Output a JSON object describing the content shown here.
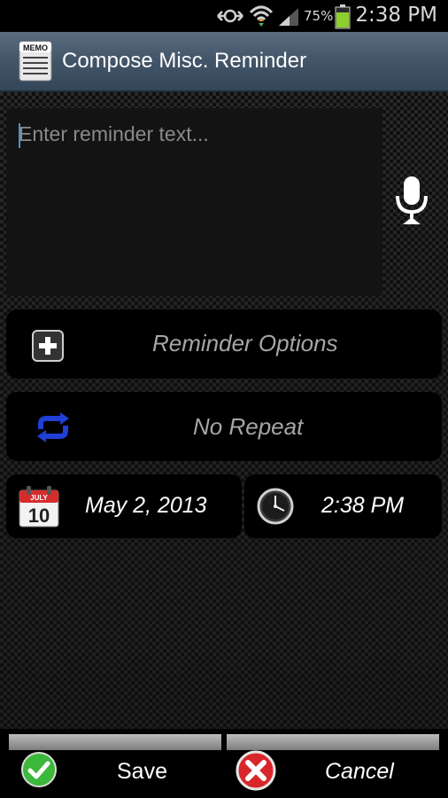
{
  "status_bar": {
    "battery_percent": "75%",
    "time": "2:38 PM"
  },
  "action_bar": {
    "title": "Compose Misc. Reminder",
    "app_icon_text": "MEMO"
  },
  "reminder_text": {
    "value": "",
    "placeholder": "Enter reminder text..."
  },
  "options": {
    "label": "Reminder Options"
  },
  "repeat": {
    "label": "No Repeat"
  },
  "date": {
    "value": "May 2, 2013",
    "calendar_month": "JULY",
    "calendar_day": "10"
  },
  "time": {
    "value": "2:38 PM"
  },
  "footer": {
    "save_label": "Save",
    "cancel_label": "Cancel"
  },
  "colors": {
    "repeat_icon": "#1f3fd6",
    "save_icon": "#3cb83a",
    "cancel_icon": "#d8262a",
    "battery": "#8ccf2e"
  },
  "icons": [
    "signal-sync-icon",
    "wifi-icon",
    "cell-signal-icon",
    "battery-icon",
    "memo-icon",
    "microphone-icon",
    "plus-box-icon",
    "repeat-icon",
    "calendar-icon",
    "clock-icon",
    "checkmark-icon",
    "x-icon"
  ]
}
